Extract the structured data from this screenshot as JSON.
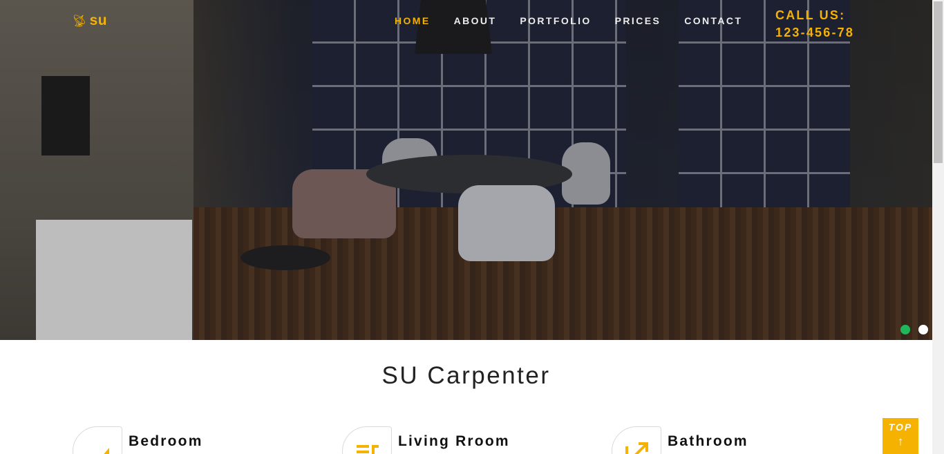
{
  "header": {
    "logo_text": "su",
    "logo_icon": "signal-icon",
    "nav": [
      "HOME",
      "ABOUT",
      "PORTFOLIO",
      "PRICES",
      "CONTACT"
    ],
    "active_nav": "HOME",
    "call_label": "CALL US:",
    "call_number": "123-456-78"
  },
  "hero": {
    "slider_dots": [
      {
        "state": "active",
        "color": "#20b75c"
      },
      {
        "state": "inactive",
        "color": "#ffffff"
      }
    ]
  },
  "main": {
    "title": "SU Carpenter",
    "features": [
      {
        "title": "Bedroom",
        "icon": "pencil-icon"
      },
      {
        "title": "Living Rroom",
        "icon": "list-icon"
      },
      {
        "title": "Bathroom",
        "icon": "external-link-icon"
      }
    ]
  },
  "top_button": {
    "label": "TOP",
    "arrow": "↑"
  },
  "colors": {
    "accent": "#f6b200",
    "slider_active": "#20b75c",
    "text_dark": "#222222"
  }
}
